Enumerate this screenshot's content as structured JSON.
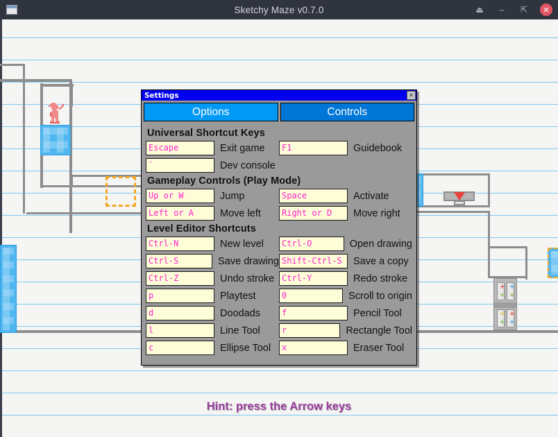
{
  "window": {
    "title": "Sketchy Maze v0.7.0",
    "icon": "window-icon",
    "buttons": {
      "eject": "⏏",
      "minimize": "–",
      "maximize": "⇱",
      "close": "✕"
    }
  },
  "game": {
    "hint": "Hint: press the Arrow keys",
    "hint_color": "#9b3fa0"
  },
  "dialog": {
    "title": "Settings",
    "close_label": "✕",
    "tabs": [
      {
        "label": "Options",
        "active": true,
        "color": "#0099f5"
      },
      {
        "label": "Controls",
        "active": false,
        "color": "#0077d6"
      }
    ],
    "sections": [
      {
        "heading": "Universal Shortcut Keys",
        "rows": [
          {
            "left": {
              "key": "Escape",
              "label": "Exit game"
            },
            "right": {
              "key": "F1",
              "label": "Guidebook"
            }
          },
          {
            "left": {
              "key": "`",
              "label": "Dev console"
            },
            "right": {
              "key": "",
              "label": ""
            }
          }
        ]
      },
      {
        "heading": "Gameplay Controls (Play Mode)",
        "rows": [
          {
            "left": {
              "key": "Up or W",
              "label": "Jump"
            },
            "right": {
              "key": "Space",
              "label": "Activate"
            }
          },
          {
            "left": {
              "key": "Left or A",
              "label": "Move left"
            },
            "right": {
              "key": "Right or D",
              "label": "Move right"
            }
          }
        ]
      },
      {
        "heading": "Level Editor Shortcuts",
        "rows": [
          {
            "left": {
              "key": "Ctrl-N",
              "label": "New level"
            },
            "right": {
              "key": "Ctrl-O",
              "label": "Open drawing"
            }
          },
          {
            "left": {
              "key": "Ctrl-S",
              "label": "Save drawing"
            },
            "right": {
              "key": "Shift-Ctrl-S",
              "label": "Save a copy"
            }
          },
          {
            "left": {
              "key": "Ctrl-Z",
              "label": "Undo stroke"
            },
            "right": {
              "key": "Ctrl-Y",
              "label": "Redo stroke"
            }
          },
          {
            "left": {
              "key": "p",
              "label": "Playtest"
            },
            "right": {
              "key": "0",
              "label": "Scroll to origin"
            }
          },
          {
            "left": {
              "key": "d",
              "label": "Doodads"
            },
            "right": {
              "key": "f",
              "label": "Pencil Tool"
            }
          },
          {
            "left": {
              "key": "l",
              "label": "Line Tool"
            },
            "right": {
              "key": "r",
              "label": "Rectangle Tool"
            }
          },
          {
            "left": {
              "key": "c",
              "label": "Ellipse Tool"
            },
            "right": {
              "key": "x",
              "label": "Eraser Tool"
            }
          }
        ]
      }
    ]
  }
}
